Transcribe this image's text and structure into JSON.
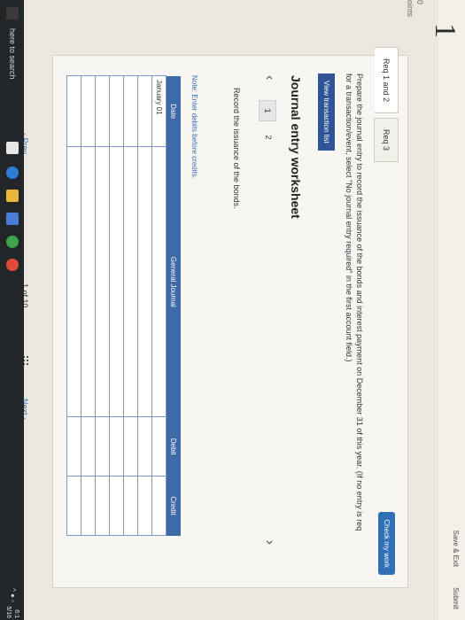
{
  "header": {
    "question_number": "1",
    "points_value": "0",
    "points_label": "oints",
    "save_exit": "Save & Exit",
    "submit": "Submit"
  },
  "check_work": "Check my work",
  "tabs": [
    {
      "label": "Req 1 and 2"
    },
    {
      "label": "Req 3"
    }
  ],
  "instructions": "Prepare the journal entry to record the issuance of the bonds and interest payment on December 31 of this year. (If no entry is req for a transaction/event, select \"No journal entry required\" in the first account field.)",
  "view_transaction_list": "View transaction list",
  "worksheet": {
    "title": "Journal entry worksheet",
    "pages": [
      "1",
      "2"
    ],
    "record_text": "Record the issuance of the bonds.",
    "note": "Note: Enter debits before credits.",
    "columns": [
      "Date",
      "General Journal",
      "Debit",
      "Credit"
    ],
    "rows": [
      {
        "date": "January 01",
        "account": "",
        "debit": "",
        "credit": ""
      },
      {
        "date": "",
        "account": "",
        "debit": "",
        "credit": ""
      },
      {
        "date": "",
        "account": "",
        "debit": "",
        "credit": ""
      },
      {
        "date": "",
        "account": "",
        "debit": "",
        "credit": ""
      },
      {
        "date": "",
        "account": "",
        "debit": "",
        "credit": ""
      },
      {
        "date": "",
        "account": "",
        "debit": "",
        "credit": ""
      },
      {
        "date": "",
        "account": "",
        "debit": "",
        "credit": ""
      }
    ]
  },
  "pager": {
    "prev": "Prev",
    "page": "1 of 10",
    "next": "Next"
  },
  "taskbar": {
    "search": "here to search",
    "clock_time": "6:1",
    "clock_date": "5/16"
  },
  "colors": {
    "accent": "#2f6fb6",
    "table_header": "#3e6aa8",
    "view_button": "#2f5597"
  }
}
